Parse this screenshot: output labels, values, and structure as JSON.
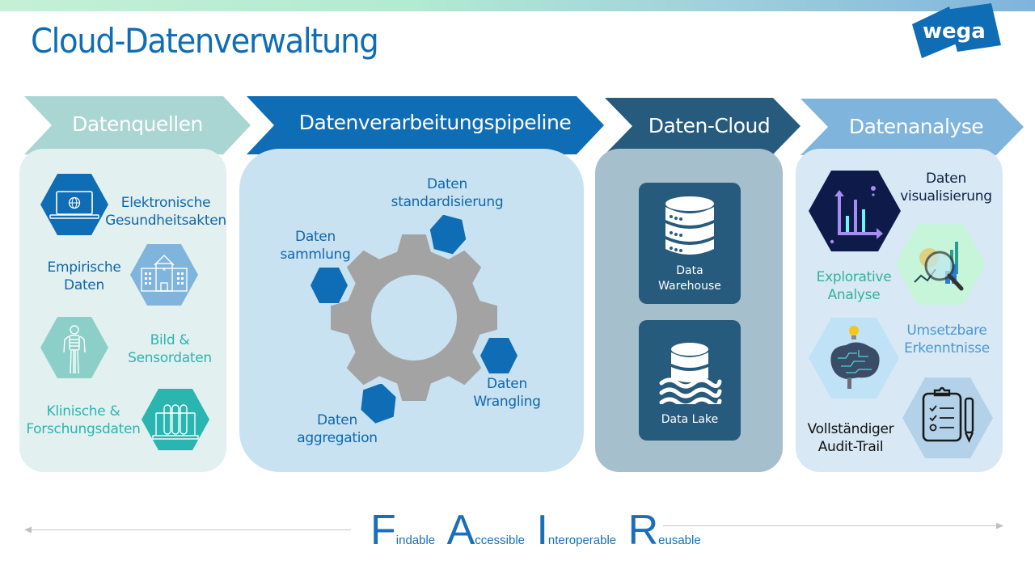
{
  "title": "Cloud-Datenverwaltung",
  "logo": {
    "text": "wega",
    "color": "#0f6db5"
  },
  "stages": [
    {
      "label": "Datenquellen",
      "color": "#a9d6d3"
    },
    {
      "label": "Datenverarbeitungspipeline",
      "color": "#0f6db5"
    },
    {
      "label": "Daten-Cloud",
      "color": "#265b7d"
    },
    {
      "label": "Datenanalyse",
      "color": "#7fb4dc"
    }
  ],
  "sources": [
    {
      "line1": "Elektronische",
      "line2": "Gesundheitsakten",
      "icon": "laptop-globe-icon"
    },
    {
      "line1": "Empirische",
      "line2": "Daten",
      "icon": "hospital-icon"
    },
    {
      "line1": "Bild &",
      "line2": "Sensordaten",
      "icon": "skeleton-icon"
    },
    {
      "line1": "Klinische &",
      "line2": "Forschungsdaten",
      "icon": "test-tubes-icon"
    }
  ],
  "pipeline": [
    {
      "line1": "Daten",
      "line2": "standardisierung"
    },
    {
      "line1": "Daten",
      "line2": "sammlung"
    },
    {
      "line1": "Daten",
      "line2": "Wrangling"
    },
    {
      "line1": "Daten",
      "line2": "aggregation"
    }
  ],
  "cloud": [
    {
      "line1": "Data",
      "line2": "Warehouse",
      "icon": "database-icon"
    },
    {
      "line1": "Data Lake",
      "line2": "",
      "icon": "data-lake-icon"
    }
  ],
  "analysis": [
    {
      "line1": "Daten",
      "line2": "visualisierung",
      "icon": "bar-chart-icon"
    },
    {
      "line1": "Explorative",
      "line2": "Analyse",
      "icon": "magnifier-chart-icon"
    },
    {
      "line1": "Umsetzbare",
      "line2": "Erkenntnisse",
      "icon": "brain-bulb-icon"
    },
    {
      "line1": "Vollständiger",
      "line2": "Audit-Trail",
      "icon": "clipboard-checklist-icon"
    }
  ],
  "fair": [
    {
      "letter": "F",
      "rest": "indable"
    },
    {
      "letter": "A",
      "rest": "ccessible"
    },
    {
      "letter": "I",
      "rest": "nteroperable"
    },
    {
      "letter": "R",
      "rest": "eusable"
    }
  ]
}
